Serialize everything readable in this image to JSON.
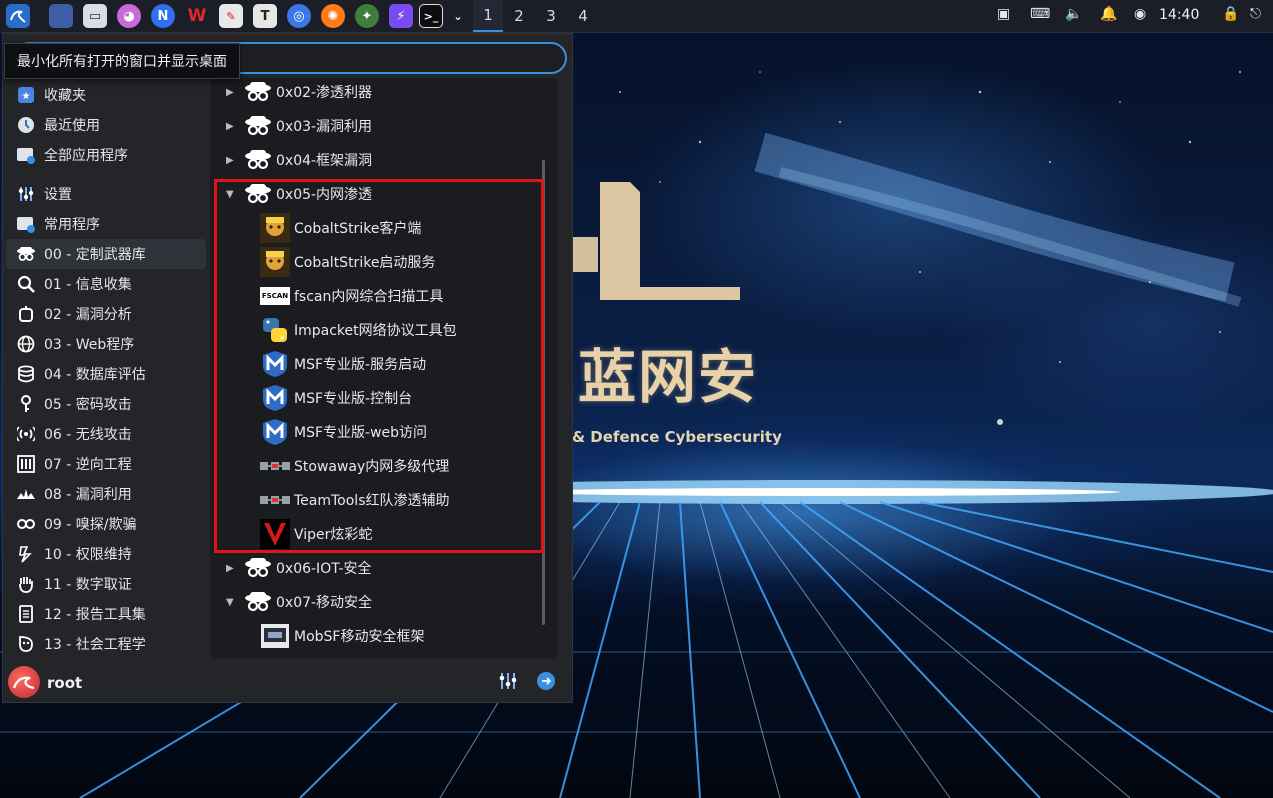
{
  "taskbar": {
    "workspaces": [
      "1",
      "2",
      "3",
      "4"
    ],
    "active_workspace": "1",
    "clock": "14:40",
    "pinned_icons": [
      "kali-menu-icon",
      "desktop-icon",
      "files-icon",
      "cat-icon",
      "n-app-icon",
      "wps-icon",
      "pdf-icon",
      "typora-icon",
      "chromium-icon",
      "firefox-icon",
      "game-icon",
      "bolt-icon",
      "terminal-icon",
      "dropdown-icon"
    ],
    "tray_icons": [
      "screen-icon",
      "keyboard-icon",
      "volume-icon",
      "bell-icon",
      "power-icon",
      "lock-icon",
      "logout-icon"
    ]
  },
  "tooltip": "最小化所有打开的窗口并显示桌面",
  "search": {
    "value": ""
  },
  "sidebar": {
    "top": [
      {
        "label": "收藏夹",
        "icon": "star-icon"
      },
      {
        "label": "最近使用",
        "icon": "clock-icon"
      },
      {
        "label": "全部应用程序",
        "icon": "folder-icon"
      }
    ],
    "categories": [
      {
        "label": "设置",
        "icon": "settings-icon"
      },
      {
        "label": "常用程序",
        "icon": "folder-icon"
      },
      {
        "label": "00 - 定制武器库",
        "icon": "spy-icon"
      },
      {
        "label": "01 - 信息收集",
        "icon": "magnifier-icon"
      },
      {
        "label": "02 - 漏洞分析",
        "icon": "bug-icon"
      },
      {
        "label": "03 - Web程序",
        "icon": "globe-icon"
      },
      {
        "label": "04 - 数据库评估",
        "icon": "database-icon"
      },
      {
        "label": "05 - 密码攻击",
        "icon": "key-icon"
      },
      {
        "label": "06 - 无线攻击",
        "icon": "wireless-icon"
      },
      {
        "label": "07 - 逆向工程",
        "icon": "reverse-icon"
      },
      {
        "label": "08 - 漏洞利用",
        "icon": "exploit-icon"
      },
      {
        "label": "09 - 嗅探/欺骗",
        "icon": "sniff-icon"
      },
      {
        "label": "10 - 权限维持",
        "icon": "persistence-icon"
      },
      {
        "label": "11 - 数字取证",
        "icon": "hand-icon"
      },
      {
        "label": "12 - 报告工具集",
        "icon": "report-icon"
      },
      {
        "label": "13 - 社会工程学",
        "icon": "social-icon"
      }
    ],
    "selected": "00 - 定制武器库"
  },
  "tree": {
    "folders": [
      {
        "label": "0x02-渗透利器",
        "expanded": false
      },
      {
        "label": "0x03-漏洞利用",
        "expanded": false
      },
      {
        "label": "0x04-框架漏洞",
        "expanded": false
      },
      {
        "label": "0x05-内网渗透",
        "expanded": true
      },
      {
        "label": "0x06-IOT-安全",
        "expanded": false
      },
      {
        "label": "0x07-移动安全",
        "expanded": true
      }
    ],
    "apps_0x05": [
      {
        "label": "CobaltStrike客户端",
        "icon": "cobaltstrike-icon"
      },
      {
        "label": "CobaltStrike启动服务",
        "icon": "cobaltstrike-icon"
      },
      {
        "label": "fscan内网综合扫描工具",
        "icon": "fscan-icon",
        "icon_text": "FSCAN"
      },
      {
        "label": "Impacket网络协议工具包",
        "icon": "python-icon"
      },
      {
        "label": "MSF专业版-服务启动",
        "icon": "metasploit-icon"
      },
      {
        "label": "MSF专业版-控制台",
        "icon": "metasploit-icon"
      },
      {
        "label": "MSF专业版-web访问",
        "icon": "metasploit-icon"
      },
      {
        "label": "Stowaway内网多级代理",
        "icon": "stowaway-icon"
      },
      {
        "label": "TeamTools红队渗透辅助",
        "icon": "teamtools-icon"
      },
      {
        "label": "Viper炫彩蛇",
        "icon": "viper-icon"
      }
    ],
    "apps_0x07": [
      {
        "label": "MobSF移动安全框架",
        "icon": "mobsf-icon"
      }
    ]
  },
  "user": {
    "name": "root"
  },
  "wallpaper": {
    "brand": "蓝网安",
    "subtitle": "& Defence Cybersecurity"
  },
  "colors": {
    "accent": "#3a8fe0",
    "highlight_box": "#e0151c",
    "menu_bg": "#232529"
  }
}
